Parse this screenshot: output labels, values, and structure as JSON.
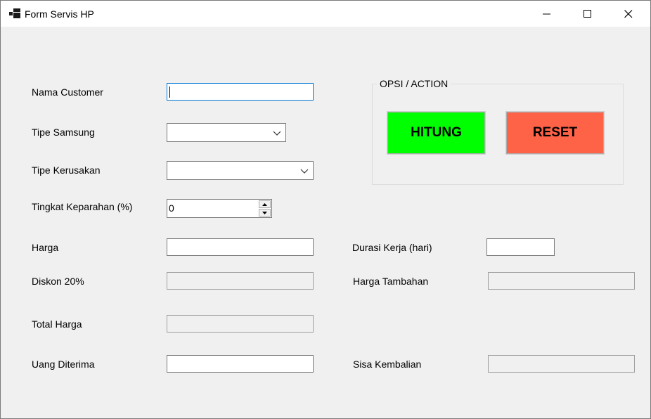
{
  "window": {
    "title": "Form Servis HP",
    "icon": "app-icon"
  },
  "form": {
    "nama_customer": {
      "label": "Nama Customer",
      "value": ""
    },
    "tipe_samsung": {
      "label": "Tipe Samsung",
      "value": ""
    },
    "tipe_kerusakan": {
      "label": "Tipe Kerusakan",
      "value": ""
    },
    "tingkat_keparahan": {
      "label": "Tingkat Keparahan (%)",
      "value": "0"
    },
    "harga": {
      "label": "Harga",
      "value": ""
    },
    "diskon": {
      "label": "Diskon 20%",
      "value": ""
    },
    "total_harga": {
      "label": "Total Harga",
      "value": ""
    },
    "uang_diterima": {
      "label": "Uang Diterima",
      "value": ""
    },
    "durasi_kerja": {
      "label": "Durasi Kerja (hari)",
      "value": ""
    },
    "harga_tambahan": {
      "label": "Harga Tambahan",
      "value": ""
    },
    "sisa_kembalian": {
      "label": "Sisa Kembalian",
      "value": ""
    }
  },
  "actions": {
    "group_label": "OPSI / ACTION",
    "hitung": {
      "label": "HITUNG",
      "color": "#00ff00"
    },
    "reset": {
      "label": "RESET",
      "color": "#ff6347"
    }
  }
}
